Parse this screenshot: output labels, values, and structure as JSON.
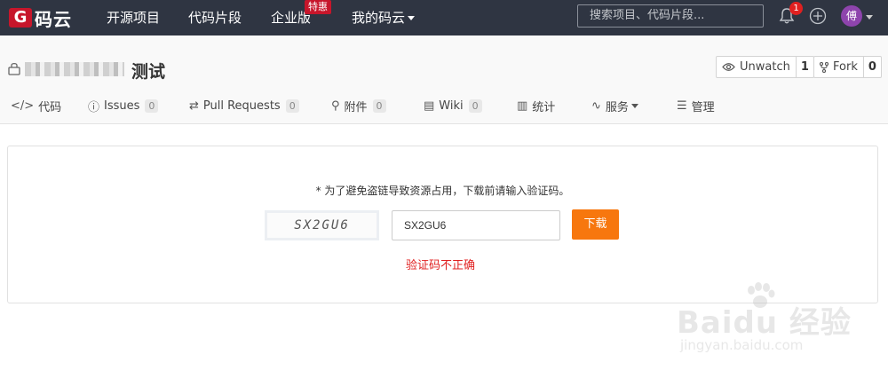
{
  "topbar": {
    "logo_mark": "G",
    "logo_text": "码云",
    "nav": [
      "开源项目",
      "代码片段",
      "企业版",
      "我的码云"
    ],
    "enterprise_badge": "特惠",
    "search_placeholder": "搜索项目、代码片段...",
    "notification_count": "1",
    "avatar_text": "傅"
  },
  "repo": {
    "name": "测试",
    "watch_label": "Unwatch",
    "watch_count": "1",
    "fork_label": "Fork",
    "fork_count": "0"
  },
  "tabs": [
    {
      "icon": "code-icon",
      "glyph": "</>",
      "label": "代码",
      "count": ""
    },
    {
      "icon": "issues-icon",
      "glyph": "ⓘ",
      "label": "Issues",
      "count": "0"
    },
    {
      "icon": "pull-request-icon",
      "glyph": "⇄",
      "label": "Pull Requests",
      "count": "0"
    },
    {
      "icon": "attachment-icon",
      "glyph": "⚲",
      "label": "附件",
      "count": "0"
    },
    {
      "icon": "wiki-icon",
      "glyph": "▤",
      "label": "Wiki",
      "count": "0"
    },
    {
      "icon": "stats-icon",
      "glyph": "▥",
      "label": "统计",
      "count": ""
    },
    {
      "icon": "service-icon",
      "glyph": "∿",
      "label": "服务",
      "count": ""
    },
    {
      "icon": "manage-icon",
      "glyph": "☰",
      "label": "管理",
      "count": ""
    }
  ],
  "captcha": {
    "hint": "* 为了避免盗链导致资源占用，下载前请输入验证码。",
    "image_text": "SX2GU6",
    "input_value": "SX2GU6",
    "button_label": "下载",
    "error": "验证码不正确"
  },
  "watermark": {
    "title": "Baidu 经验",
    "url": "jingyan.baidu.com"
  },
  "colors": {
    "topbar": "#2f3542",
    "brand": "#c7162b",
    "download": "#f7770e",
    "error": "#e02020"
  }
}
